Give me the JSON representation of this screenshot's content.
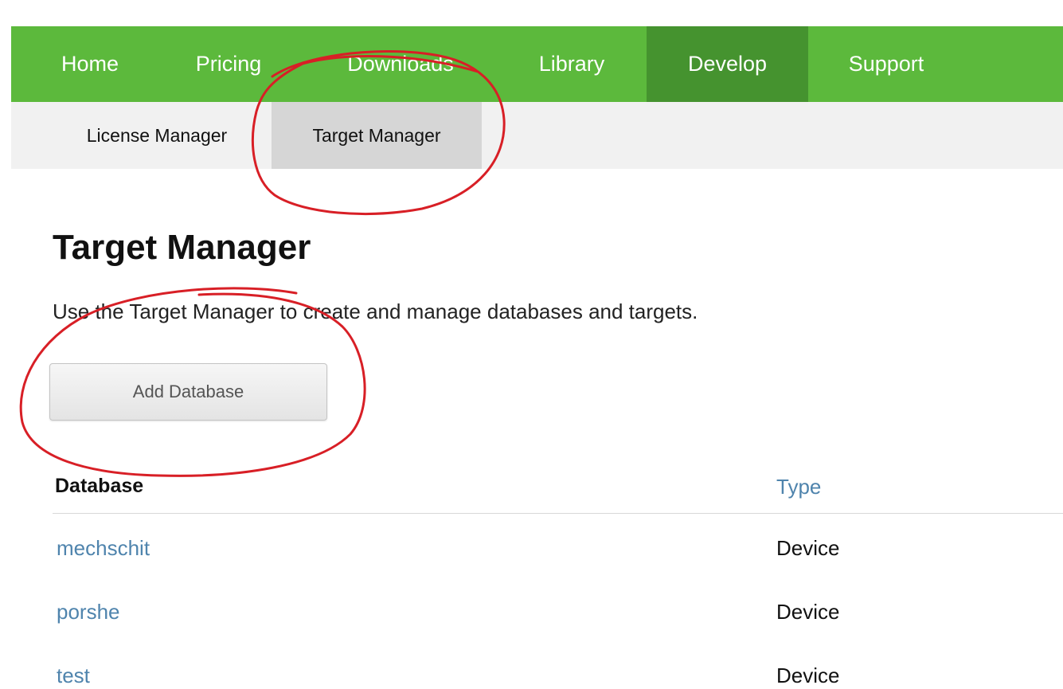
{
  "main_nav": {
    "items": [
      {
        "label": "Home"
      },
      {
        "label": "Pricing"
      },
      {
        "label": "Downloads"
      },
      {
        "label": "Library"
      },
      {
        "label": "Develop"
      },
      {
        "label": "Support"
      }
    ],
    "active": "Develop"
  },
  "sub_nav": {
    "items": [
      {
        "label": "License Manager"
      },
      {
        "label": "Target Manager"
      }
    ],
    "active": "Target Manager"
  },
  "page": {
    "title": "Target Manager",
    "description": "Use the Target Manager to create and manage databases and targets.",
    "add_button_label": "Add Database"
  },
  "table": {
    "headers": {
      "database": "Database",
      "type": "Type"
    },
    "rows": [
      {
        "name": "mechschit",
        "type": "Device"
      },
      {
        "name": "porshe",
        "type": "Device"
      },
      {
        "name": "test",
        "type": "Device"
      }
    ]
  },
  "colors": {
    "nav_green": "#5cb93c",
    "nav_active": "#45932f",
    "link_blue": "#4f84ad",
    "annotation_red": "#d81f26"
  }
}
